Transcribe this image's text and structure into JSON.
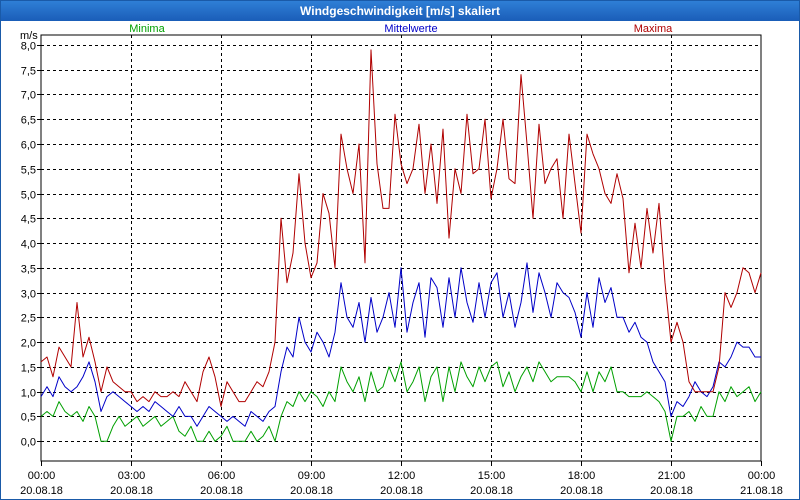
{
  "window": {
    "title": "Windgeschwindigkeit [m/s] skaliert"
  },
  "chart_data": {
    "type": "line",
    "title": "Windgeschwindigkeit [m/s] skaliert",
    "ylabel": "m/s",
    "xlabel": "",
    "ylim": [
      -0.4,
      8.2
    ],
    "xlim_hours": [
      0,
      24
    ],
    "grid": true,
    "legend_placement": "top",
    "y_ticks": [
      "0,0",
      "0,5",
      "1,0",
      "1,5",
      "2,0",
      "2,5",
      "3,0",
      "3,5",
      "4,0",
      "4,5",
      "5,0",
      "5,5",
      "6,0",
      "6,5",
      "7,0",
      "7,5",
      "8,0"
    ],
    "x_ticks": [
      {
        "time": "00:00",
        "date": "20.08.18"
      },
      {
        "time": "03:00",
        "date": "20.08.18"
      },
      {
        "time": "06:00",
        "date": "20.08.18"
      },
      {
        "time": "09:00",
        "date": "20.08.18"
      },
      {
        "time": "12:00",
        "date": "20.08.18"
      },
      {
        "time": "15:00",
        "date": "20.08.18"
      },
      {
        "time": "18:00",
        "date": "20.08.18"
      },
      {
        "time": "21:00",
        "date": "20.08.18"
      },
      {
        "time": "00:00",
        "date": "21.08.18"
      }
    ],
    "x_hours": [
      0.0,
      0.2,
      0.4,
      0.6,
      0.8,
      1.0,
      1.2,
      1.4,
      1.6,
      1.8,
      2.0,
      2.2,
      2.4,
      2.6,
      2.8,
      3.0,
      3.2,
      3.4,
      3.6,
      3.8,
      4.0,
      4.2,
      4.4,
      4.6,
      4.8,
      5.0,
      5.2,
      5.4,
      5.6,
      5.8,
      6.0,
      6.2,
      6.4,
      6.6,
      6.8,
      7.0,
      7.2,
      7.4,
      7.6,
      7.8,
      8.0,
      8.2,
      8.4,
      8.6,
      8.8,
      9.0,
      9.2,
      9.4,
      9.6,
      9.8,
      10.0,
      10.2,
      10.4,
      10.6,
      10.8,
      11.0,
      11.2,
      11.4,
      11.6,
      11.8,
      12.0,
      12.2,
      12.4,
      12.6,
      12.8,
      13.0,
      13.2,
      13.4,
      13.6,
      13.8,
      14.0,
      14.2,
      14.4,
      14.6,
      14.8,
      15.0,
      15.2,
      15.4,
      15.6,
      15.8,
      16.0,
      16.2,
      16.4,
      16.6,
      16.8,
      17.0,
      17.2,
      17.4,
      17.6,
      17.8,
      18.0,
      18.2,
      18.4,
      18.6,
      18.8,
      19.0,
      19.2,
      19.4,
      19.6,
      19.8,
      20.0,
      20.2,
      20.4,
      20.6,
      20.8,
      21.0,
      21.2,
      21.4,
      21.6,
      21.8,
      22.0,
      22.2,
      22.4,
      22.6,
      22.8,
      23.0,
      23.2,
      23.4,
      23.6,
      23.8,
      24.0
    ],
    "series": [
      {
        "name": "Minima",
        "color": "#00a000",
        "values": [
          0.5,
          0.6,
          0.5,
          0.8,
          0.6,
          0.5,
          0.6,
          0.4,
          0.7,
          0.5,
          0.0,
          0.0,
          0.3,
          0.5,
          0.3,
          0.4,
          0.5,
          0.3,
          0.4,
          0.5,
          0.3,
          0.4,
          0.5,
          0.2,
          0.1,
          0.3,
          0.0,
          0.0,
          0.2,
          0.0,
          0.1,
          0.3,
          0.0,
          0.0,
          0.0,
          0.2,
          0.0,
          0.1,
          0.3,
          0.0,
          0.5,
          0.8,
          0.7,
          1.0,
          0.8,
          1.0,
          0.9,
          0.7,
          1.0,
          0.8,
          1.5,
          1.2,
          1.0,
          1.3,
          0.8,
          1.4,
          1.0,
          1.1,
          1.5,
          1.2,
          1.6,
          1.0,
          1.2,
          1.5,
          0.8,
          1.3,
          1.5,
          0.8,
          1.5,
          1.0,
          1.6,
          1.3,
          1.1,
          1.5,
          1.2,
          1.5,
          1.6,
          1.1,
          1.4,
          1.0,
          1.3,
          1.5,
          1.2,
          1.6,
          1.4,
          1.2,
          1.3,
          1.3,
          1.3,
          1.2,
          1.0,
          1.4,
          1.0,
          1.4,
          1.2,
          1.5,
          1.0,
          1.0,
          0.9,
          0.9,
          0.9,
          1.0,
          0.9,
          0.8,
          0.6,
          0.0,
          0.5,
          0.5,
          0.6,
          0.4,
          0.7,
          0.5,
          0.5,
          1.0,
          0.8,
          1.1,
          0.9,
          1.0,
          1.1,
          0.8,
          1.0
        ]
      },
      {
        "name": "Mittelwerte",
        "color": "#0000c8",
        "values": [
          0.9,
          1.1,
          0.9,
          1.3,
          1.1,
          1.0,
          1.1,
          1.3,
          1.6,
          1.2,
          0.6,
          0.9,
          1.0,
          0.9,
          0.8,
          0.7,
          0.6,
          0.7,
          0.6,
          0.8,
          0.7,
          0.6,
          0.5,
          0.7,
          0.5,
          0.5,
          0.3,
          0.5,
          0.7,
          0.6,
          0.5,
          0.4,
          0.5,
          0.4,
          0.3,
          0.6,
          0.5,
          0.4,
          0.6,
          0.7,
          1.4,
          1.9,
          1.7,
          2.5,
          2.0,
          1.8,
          2.2,
          2.0,
          1.7,
          2.2,
          3.2,
          2.5,
          2.3,
          2.8,
          2.0,
          2.9,
          2.2,
          2.5,
          3.0,
          2.3,
          3.5,
          2.2,
          2.8,
          3.2,
          2.1,
          3.3,
          3.1,
          2.3,
          3.3,
          2.5,
          3.5,
          2.8,
          2.4,
          3.2,
          2.5,
          3.2,
          3.4,
          2.5,
          3.0,
          2.3,
          2.8,
          3.6,
          2.6,
          3.4,
          3.0,
          2.5,
          3.2,
          3.0,
          2.9,
          2.6,
          2.1,
          3.0,
          2.3,
          3.3,
          2.8,
          3.1,
          2.5,
          2.5,
          2.2,
          2.4,
          2.1,
          2.0,
          1.6,
          1.4,
          1.2,
          0.5,
          0.8,
          0.7,
          0.9,
          1.2,
          1.0,
          0.9,
          1.1,
          1.6,
          1.5,
          1.7,
          2.0,
          1.9,
          1.9,
          1.7,
          1.7
        ]
      },
      {
        "name": "Maxima",
        "color": "#b00000",
        "values": [
          1.6,
          1.7,
          1.3,
          1.9,
          1.7,
          1.5,
          2.8,
          1.7,
          2.1,
          1.6,
          1.0,
          1.5,
          1.2,
          1.1,
          1.0,
          1.0,
          0.8,
          0.9,
          0.8,
          1.0,
          0.9,
          0.9,
          1.0,
          0.9,
          1.2,
          1.0,
          0.8,
          1.4,
          1.7,
          1.3,
          0.7,
          1.2,
          1.0,
          0.8,
          0.8,
          1.0,
          1.2,
          1.1,
          1.4,
          2.0,
          4.5,
          3.2,
          3.8,
          5.4,
          4.0,
          3.3,
          3.6,
          5.0,
          4.6,
          3.5,
          6.2,
          5.5,
          5.0,
          6.0,
          3.6,
          7.9,
          5.6,
          4.7,
          4.7,
          6.6,
          5.6,
          5.2,
          5.5,
          6.4,
          5.0,
          6.0,
          4.8,
          6.3,
          4.1,
          5.5,
          5.0,
          6.6,
          5.4,
          5.5,
          6.5,
          4.9,
          5.5,
          6.5,
          5.3,
          5.2,
          7.4,
          6.0,
          4.5,
          6.4,
          5.2,
          5.5,
          5.7,
          4.5,
          6.2,
          5.2,
          4.2,
          6.2,
          5.8,
          5.5,
          5.0,
          4.8,
          5.4,
          4.9,
          3.4,
          4.4,
          3.5,
          4.7,
          3.8,
          4.8,
          3.2,
          2.0,
          2.4,
          2.0,
          1.2,
          1.0,
          1.0,
          1.0,
          1.0,
          1.5,
          3.0,
          2.7,
          3.0,
          3.5,
          3.4,
          3.0,
          3.4
        ]
      }
    ]
  }
}
